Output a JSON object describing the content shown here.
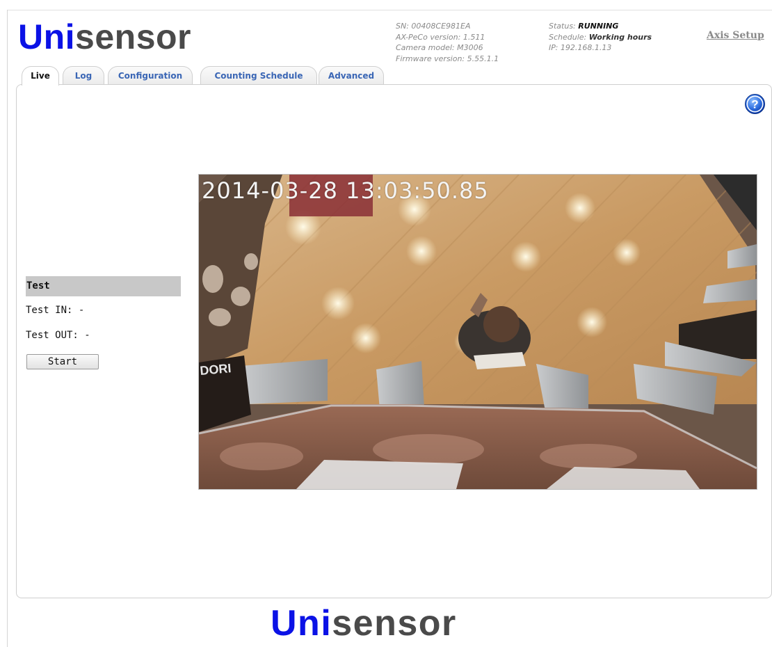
{
  "logo": {
    "uni": "Uni",
    "sensor": "sensor"
  },
  "device_info": {
    "sn_label": "SN:",
    "sn": "00408CE981EA",
    "version_label": "AX-PeCo version:",
    "version": "1.511",
    "model_label": "Camera model:",
    "model": "M3006",
    "firmware_label": "Firmware version:",
    "firmware": "5.55.1.1"
  },
  "status_info": {
    "status_label": "Status:",
    "status": "RUNNING",
    "schedule_label": "Schedule:",
    "schedule": "Working hours",
    "ip_label": "IP:",
    "ip": "192.168.1.13"
  },
  "header": {
    "axis_setup": "Axis Setup"
  },
  "tabs": [
    {
      "label": "Live",
      "active": true
    },
    {
      "label": "Log"
    },
    {
      "label": "Configuration"
    },
    {
      "label": "Counting Schedule"
    },
    {
      "label": "Advanced"
    }
  ],
  "test": {
    "title": "Test",
    "in_label": "Test IN:",
    "in_value": "-",
    "out_label": "Test OUT:",
    "out_value": "-",
    "start_label": "Start"
  },
  "video": {
    "timestamp": "2014-03-28 13:03:50.85"
  },
  "icons": {
    "help": "help-icon"
  },
  "colors": {
    "brand_blue": "#0b12e6",
    "brand_gray": "#4a4a4a",
    "tab_link": "#3a66b5"
  }
}
